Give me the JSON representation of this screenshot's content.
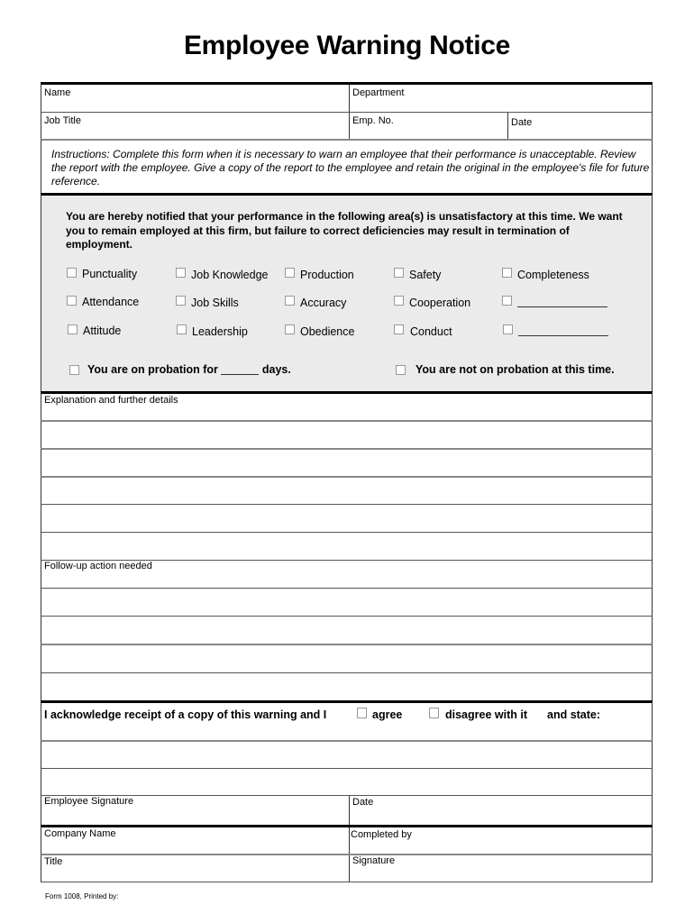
{
  "title": "Employee Warning Notice",
  "header_fields": {
    "name": "Name",
    "department": "Department",
    "job_title": "Job Title",
    "emp_no": "Emp. No.",
    "date": "Date"
  },
  "instructions": "Instructions:  Complete this form when it is necessary to warn an employee that their performance is unacceptable. Review the report with the employee.  Give a copy of the report to the employee and retain the original in the employee's file for future reference.",
  "notice": {
    "text": "You are hereby notified that your performance in the following area(s) is unsatisfactory at this time.  We want you to remain employed at this firm, but failure to correct deficiencies may result in termination of employment.",
    "areas": [
      [
        "Punctuality",
        "Job Knowledge",
        "Production",
        "Safety",
        "Completeness"
      ],
      [
        "Attendance",
        "Job Skills",
        "Accuracy",
        "Cooperation",
        ""
      ],
      [
        "Attitude",
        "Leadership",
        "Obedience",
        "Conduct",
        ""
      ]
    ],
    "probation_on_prefix": "You are on probation for",
    "probation_on_suffix": "days.",
    "probation_blank": "______",
    "probation_off": "You are not on probation at this time."
  },
  "explanation_label": "Explanation and further details",
  "followup_label": "Follow-up action needed",
  "acknowledge": {
    "text": "I acknowledge receipt of a copy of this warning and I",
    "agree": "agree",
    "disagree": "disagree with it",
    "state": "and state:"
  },
  "signature_fields": {
    "employee_signature": "Employee Signature",
    "date": "Date",
    "company_name": "Company Name",
    "completed_by": "Completed by",
    "title": "Title",
    "signature": "Signature"
  },
  "footer": "Form 1008, Printed by:"
}
